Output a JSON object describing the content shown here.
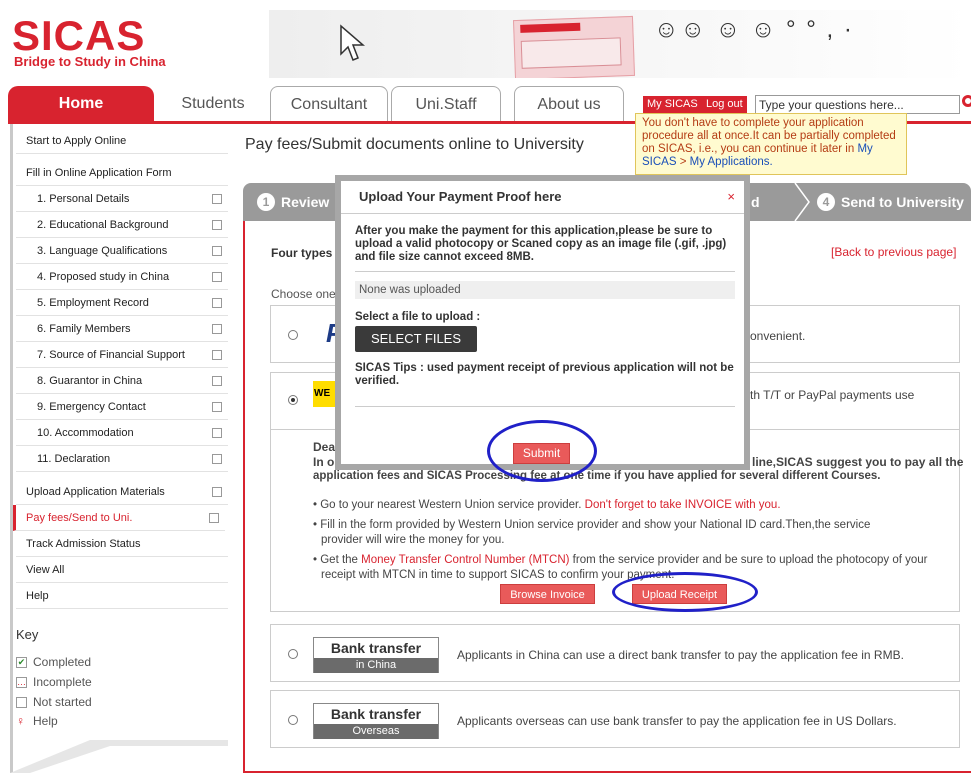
{
  "logo": {
    "name": "SICAS",
    "tagline": "Bridge to Study in China"
  },
  "nav": {
    "tabs": [
      {
        "label": "Home"
      },
      {
        "label": "Students"
      },
      {
        "label": "Consultant"
      },
      {
        "label": "Uni.Staff"
      },
      {
        "label": "About us"
      }
    ],
    "my_sicas": "My SICAS",
    "logout": "Log out",
    "search_value": "Type your questions here..."
  },
  "tooltip": {
    "text": "You don't have to complete your application procedure all at once.It can be partially completed on SICAS, i.e., you can continue it later in",
    "link1": "My SICAS",
    "sep": " > ",
    "link2": "My Applications."
  },
  "sidebar": {
    "start": "Start to Apply Online",
    "fill": "Fill in Online Application Form",
    "items": [
      "1. Personal Details",
      "2. Educational Background",
      "3. Language Qualifications",
      "4. Proposed study in China",
      "5. Employment Record",
      "6. Family Members",
      "7. Source of Financial Support",
      "8. Guarantor in China",
      "9. Emergency Contact",
      "10. Accommodation",
      "11. Declaration"
    ],
    "upload": "Upload Application Materials",
    "pay": "Pay fees/Send to Uni.",
    "track": "Track Admission Status",
    "view_all": "View All",
    "help": "Help",
    "key": {
      "title": "Key",
      "completed": "Completed",
      "incomplete": "Incomplete",
      "not_started": "Not started",
      "help": "Help"
    }
  },
  "main": {
    "title": "Pay fees/Submit documents online to University",
    "steps": [
      {
        "num": "1",
        "label": "Review"
      },
      {
        "num": "",
        "label": "d"
      },
      {
        "num": "4",
        "label": "Send to University"
      }
    ],
    "four_types": "Four types",
    "back": "[Back to previous page]",
    "choose_one": "Choose one",
    "paypal_desc": "onvenient.",
    "wu_desc": "th T/T or PayPal payments use",
    "wu_dear": "Dear",
    "wu_inorder": "In ord",
    "wu_right": "line,SICAS suggest you to pay all the",
    "wu_line2": "application fees and SICAS Processing fee at one time if you have applied for several different Courses.",
    "wu_bullets": [
      {
        "text": "Go to your nearest Western Union service provider. ",
        "red": "Don't forget to take INVOICE with you."
      },
      {
        "text": "Fill in the form provided by Western Union service provider and show your National ID card.Then,the service provider will wire the money for you.",
        "red": ""
      },
      {
        "text_pre": "Get the ",
        "red": "Money Transfer Control Number (MTCN)",
        "text": " from the service provider and be sure to upload the photocopy of your receipt with MTCN in time to support SICAS to confirm your payment."
      }
    ],
    "browse_invoice": "Browse Invoice",
    "upload_receipt": "Upload Receipt",
    "bank_china": {
      "title": "Bank transfer",
      "sub": "in China",
      "desc": "Applicants in China can use a direct bank transfer to pay the application fee in RMB."
    },
    "bank_overseas": {
      "title": "Bank transfer",
      "sub": "Overseas",
      "desc": "Applicants overseas can use bank transfer to pay the application fee in US Dollars."
    }
  },
  "modal": {
    "title": "Upload Your Payment Proof here",
    "close": "×",
    "text": "After you make the payment for this application,please be sure to upload a valid photocopy or Scaned copy as an image file (.gif, .jpg) and file size cannot exceed 8MB.",
    "uploaded": "None was uploaded",
    "select_label": "Select a file to upload :",
    "select_btn": "SELECT FILES",
    "tips": "SICAS Tips : used payment receipt of previous application will not be verified.",
    "submit": "Submit"
  },
  "colors": {
    "brand": "#d8232f",
    "annotation": "#2020c8"
  }
}
